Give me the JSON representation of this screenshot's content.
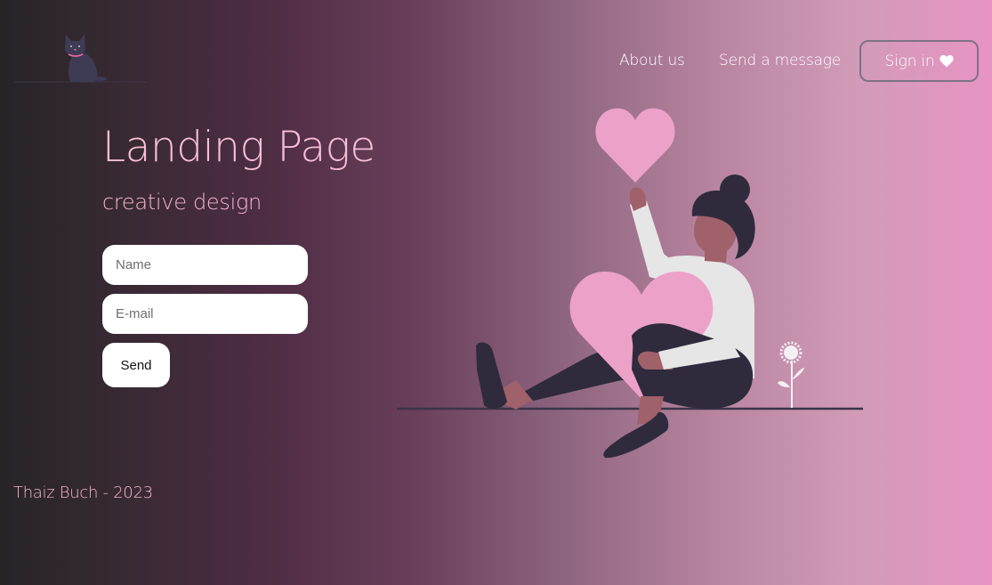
{
  "nav": {
    "about_label": "About us",
    "send_message_label": "Send a message",
    "signin_label": "Sign in"
  },
  "hero": {
    "title": "Landing Page",
    "subtitle": "creative design"
  },
  "form": {
    "name_placeholder": "Name",
    "email_placeholder": "E-mail",
    "send_label": "Send"
  },
  "footer": {
    "text": "Thaiz Buch - 2023"
  },
  "icons": {
    "logo": "cat-logo-icon",
    "signin": "heart-icon",
    "illustration": "woman-with-hearts-illustration"
  },
  "colors": {
    "accent_pink": "#f4b6cf",
    "heart_pink": "#eca1c8",
    "button_border": "#7d7285"
  }
}
